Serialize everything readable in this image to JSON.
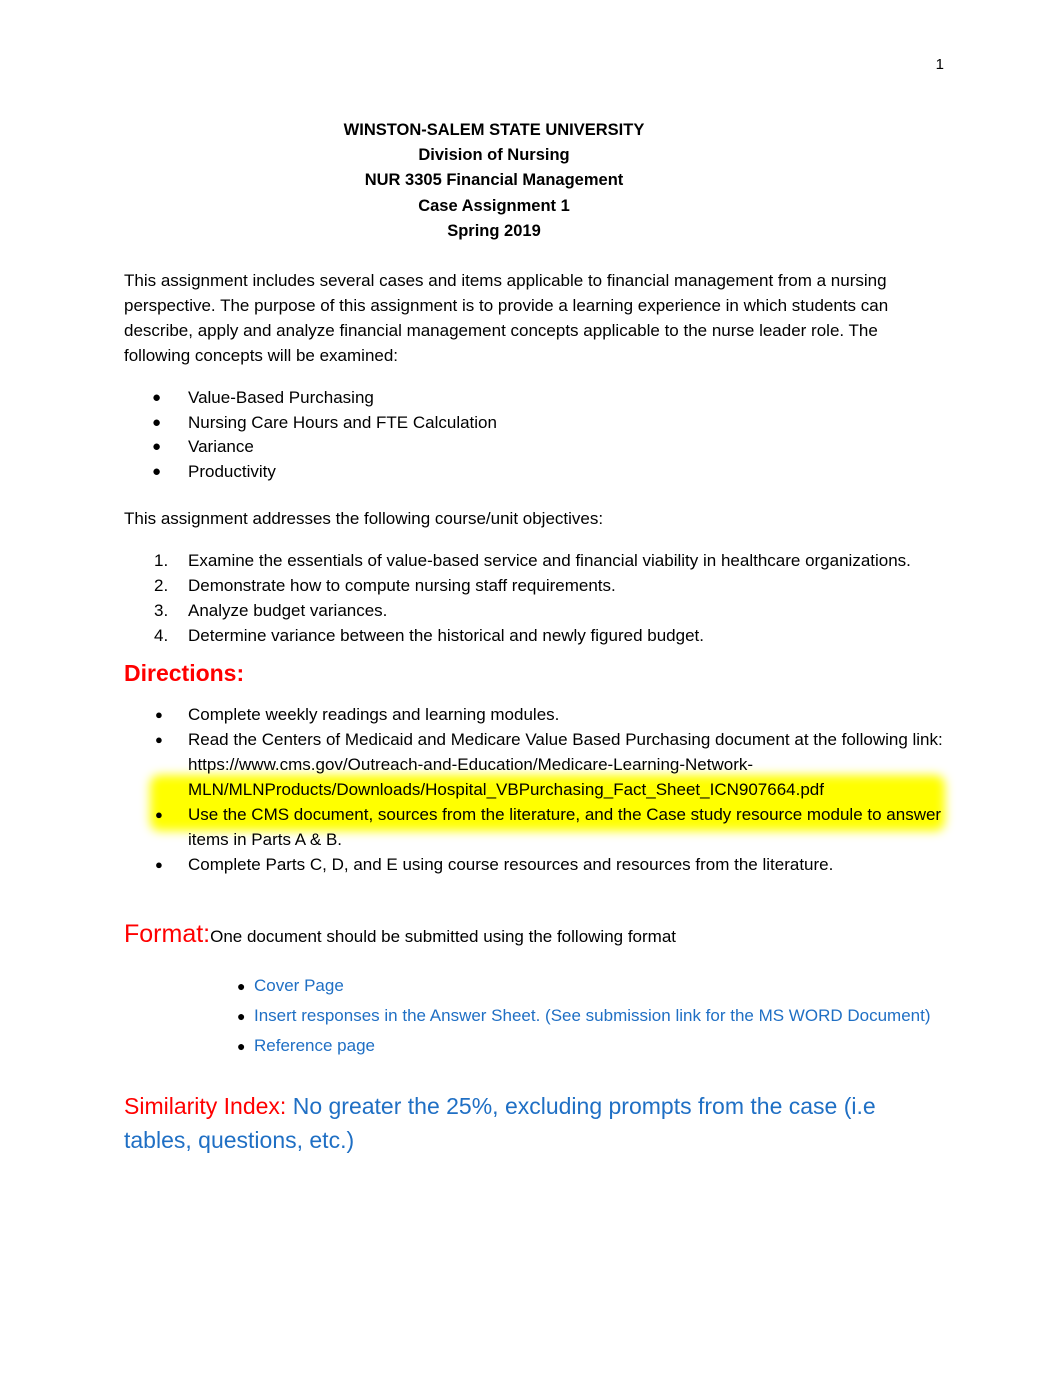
{
  "document": {
    "page_number": "1",
    "bullet_glyph": "●",
    "colors": {
      "heading_red": "#FF0000",
      "link_blue": "#1F6FC4",
      "highlight_yellow": "#FFFF00",
      "body_black": "#000000"
    }
  },
  "header": {
    "lines": [
      "WINSTON-SALEM STATE UNIVERSITY",
      "Division of Nursing",
      "NUR 3305 Financial Management",
      "Case Assignment 1",
      "Spring 2019"
    ]
  },
  "intro": {
    "paragraph": "This assignment includes several cases and items applicable to financial management from a nursing perspective. The purpose of this assignment is to provide a learning experience in which students can describe, apply and analyze financial management concepts applicable to the nurse leader role. The following concepts will be examined:"
  },
  "concepts": {
    "items": [
      "Value-Based Purchasing",
      "Nursing Care Hours and FTE Calculation",
      "Variance",
      "Productivity"
    ]
  },
  "objectives": {
    "lead_in": "This assignment addresses the following course/unit objectives:",
    "items": [
      {
        "number": "1.",
        "text": "Examine the essentials of value-based service and financial viability in healthcare organizations."
      },
      {
        "number": "2.",
        "text": "Demonstrate how to compute nursing staff requirements."
      },
      {
        "number": "3.",
        "text": "Analyze budget variances."
      },
      {
        "number": "4.",
        "text": "Determine variance between the historical and newly figured budget."
      }
    ]
  },
  "directions": {
    "heading": "Directions:",
    "items": [
      "Complete weekly readings and learning modules.",
      "Read the Centers of Medicaid and Medicare Value Based Purchasing document at the following link: https://www.cms.gov/Outreach-and-Education/Medicare-Learning-Network-MLN/MLNProducts/Downloads/Hospital_VBPurchasing_Fact_Sheet_ICN907664.pdf",
      "Use the CMS document, sources from the literature, and the Case study resource module to answer items in Parts A & B.",
      "Complete Parts C, D, and E using course resources and resources from the literature."
    ]
  },
  "format": {
    "label": "Format:",
    "lead_in": "One document should be submitted using the following format",
    "items": [
      "Cover Page",
      "Insert responses in the Answer Sheet. (See submission link for the MS WORD Document)",
      "Reference page"
    ]
  },
  "similarity": {
    "label": "Similarity Index:",
    "text": " No greater the 25%, excluding prompts from the case (i.e tables, questions, etc.)"
  }
}
